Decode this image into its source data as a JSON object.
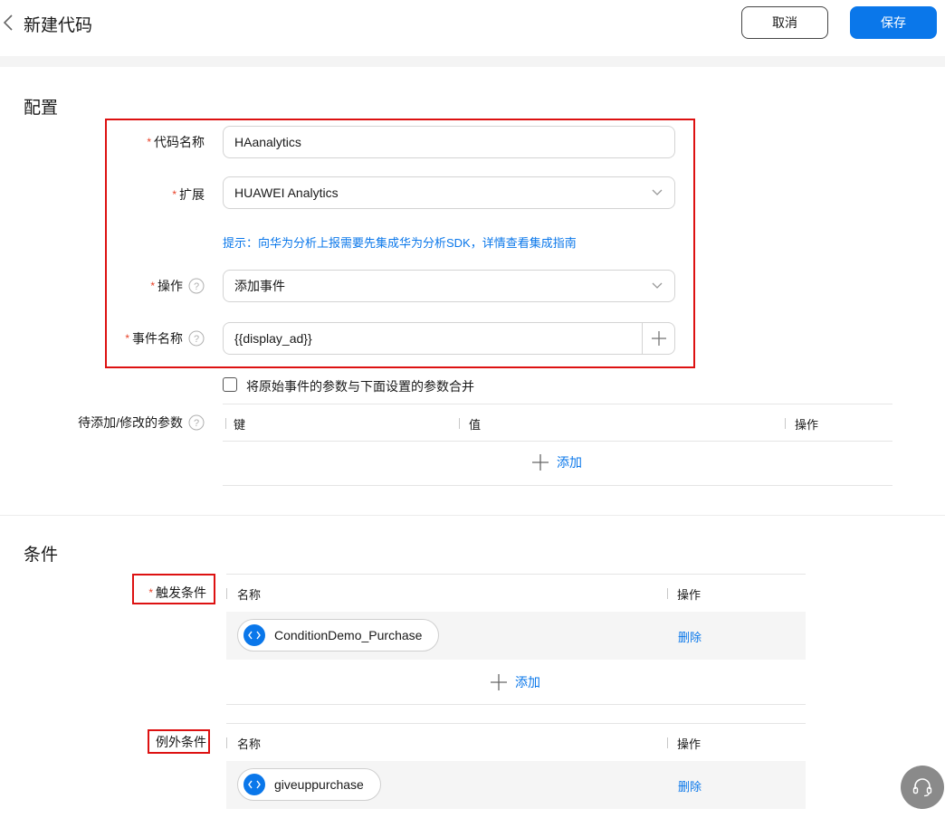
{
  "header": {
    "title": "新建代码",
    "cancel_label": "取消",
    "save_label": "保存"
  },
  "config": {
    "section_title": "配置",
    "code_name": {
      "label": "代码名称",
      "value": "HAanalytics"
    },
    "extension": {
      "label": "扩展",
      "value": "HUAWEI Analytics"
    },
    "hint": "提示：向华为分析上报需要先集成华为分析SDK，详情查看集成指南",
    "operation": {
      "label": "操作",
      "value": "添加事件"
    },
    "event_name": {
      "label": "事件名称",
      "value": "{{display_ad}}"
    },
    "merge_checkbox_label": "将原始事件的参数与下面设置的参数合并",
    "params": {
      "label": "待添加/修改的参数",
      "columns": [
        "键",
        "值",
        "操作"
      ],
      "add_label": "添加"
    }
  },
  "conditions": {
    "section_title": "条件",
    "trigger": {
      "label": "触发条件",
      "columns": [
        "名称",
        "操作"
      ],
      "rows": [
        {
          "name": "ConditionDemo_Purchase",
          "action": "删除"
        }
      ],
      "add_label": "添加"
    },
    "exception": {
      "label": "例外条件",
      "columns": [
        "名称",
        "操作"
      ],
      "rows": [
        {
          "name": "giveuppurchase",
          "action": "删除"
        }
      ]
    }
  },
  "colors": {
    "accent": "#0a77ea",
    "required": "#e84026",
    "highlight_box": "#dd1111"
  }
}
